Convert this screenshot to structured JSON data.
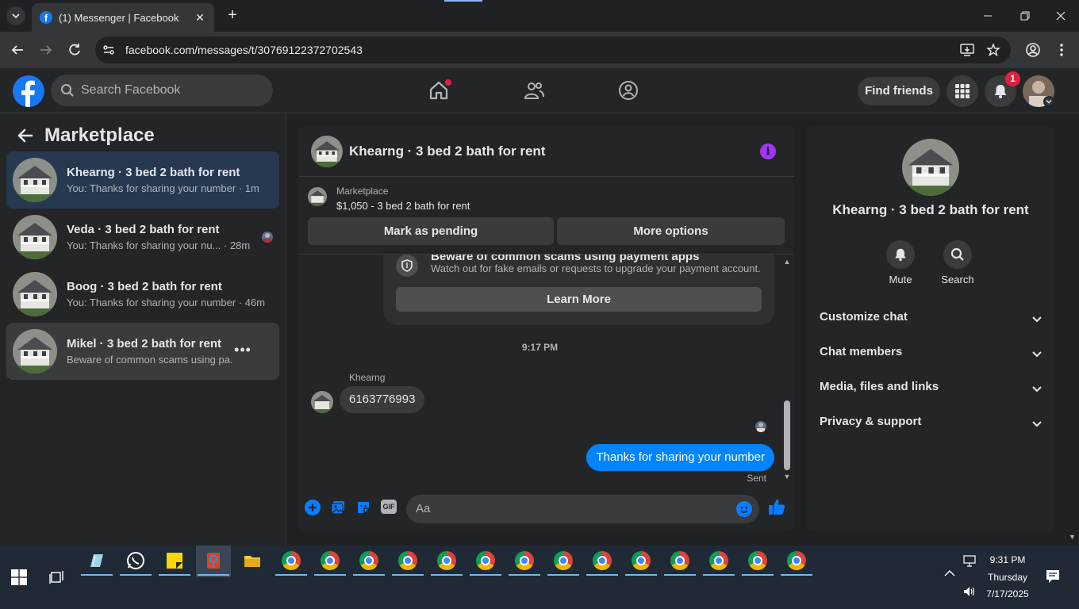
{
  "browser": {
    "tab_title": "(1) Messenger | Facebook",
    "tab_close": "✕",
    "new_tab": "+",
    "url": "facebook.com/messages/t/30769122372702543"
  },
  "header": {
    "search_placeholder": "Search Facebook",
    "find_friends": "Find friends",
    "notification_count": "1"
  },
  "sidebar": {
    "title": "Marketplace",
    "conversations": [
      {
        "name": "Khearng · 3 bed 2 bath for rent",
        "preview": "You: Thanks for sharing your number · 1m",
        "state": "active"
      },
      {
        "name": "Veda · 3 bed 2 bath for rent",
        "preview": "You: Thanks for sharing your nu...  · 28m",
        "state": "normal"
      },
      {
        "name": "Boog · 3 bed 2 bath for rent",
        "preview": "You: Thanks for sharing your number · 46m",
        "state": "normal"
      },
      {
        "name": "Mikel · 3 bed 2 bath for rent",
        "preview": "Beware of common scams using pa...   m",
        "state": "hover"
      }
    ],
    "more_dots": "•••"
  },
  "chat": {
    "title": "Khearng · 3 bed 2 bath for rent",
    "info_icon": "i",
    "marketplace_label": "Marketplace",
    "listing": "$1,050 - 3 bed 2 bath for rent",
    "mark_pending": "Mark as pending",
    "more_options": "More options",
    "warning_title": "Beware of common scams using payment apps",
    "warning_text": "Watch out for fake emails or requests to upgrade your payment account.",
    "learn_more": "Learn More",
    "timestamp": "9:17 PM",
    "sender_name": "Khearng",
    "incoming_message": "6163776993",
    "outgoing_message": "Thanks for sharing your number",
    "sent_status": "Sent",
    "composer_placeholder": "Aa",
    "gif_label": "GIF"
  },
  "details": {
    "name": "Khearng · 3 bed 2 bath for rent",
    "mute": "Mute",
    "search": "Search",
    "sections": [
      "Customize chat",
      "Chat members",
      "Media, files and links",
      "Privacy & support"
    ]
  },
  "taskbar": {
    "time": "9:31 PM",
    "day": "Thursday",
    "date": "7/17/2025"
  },
  "colors": {
    "accent": "#0084ff",
    "brand": "#1877f2",
    "info": "#a334fa",
    "badge": "#e41e3f"
  }
}
